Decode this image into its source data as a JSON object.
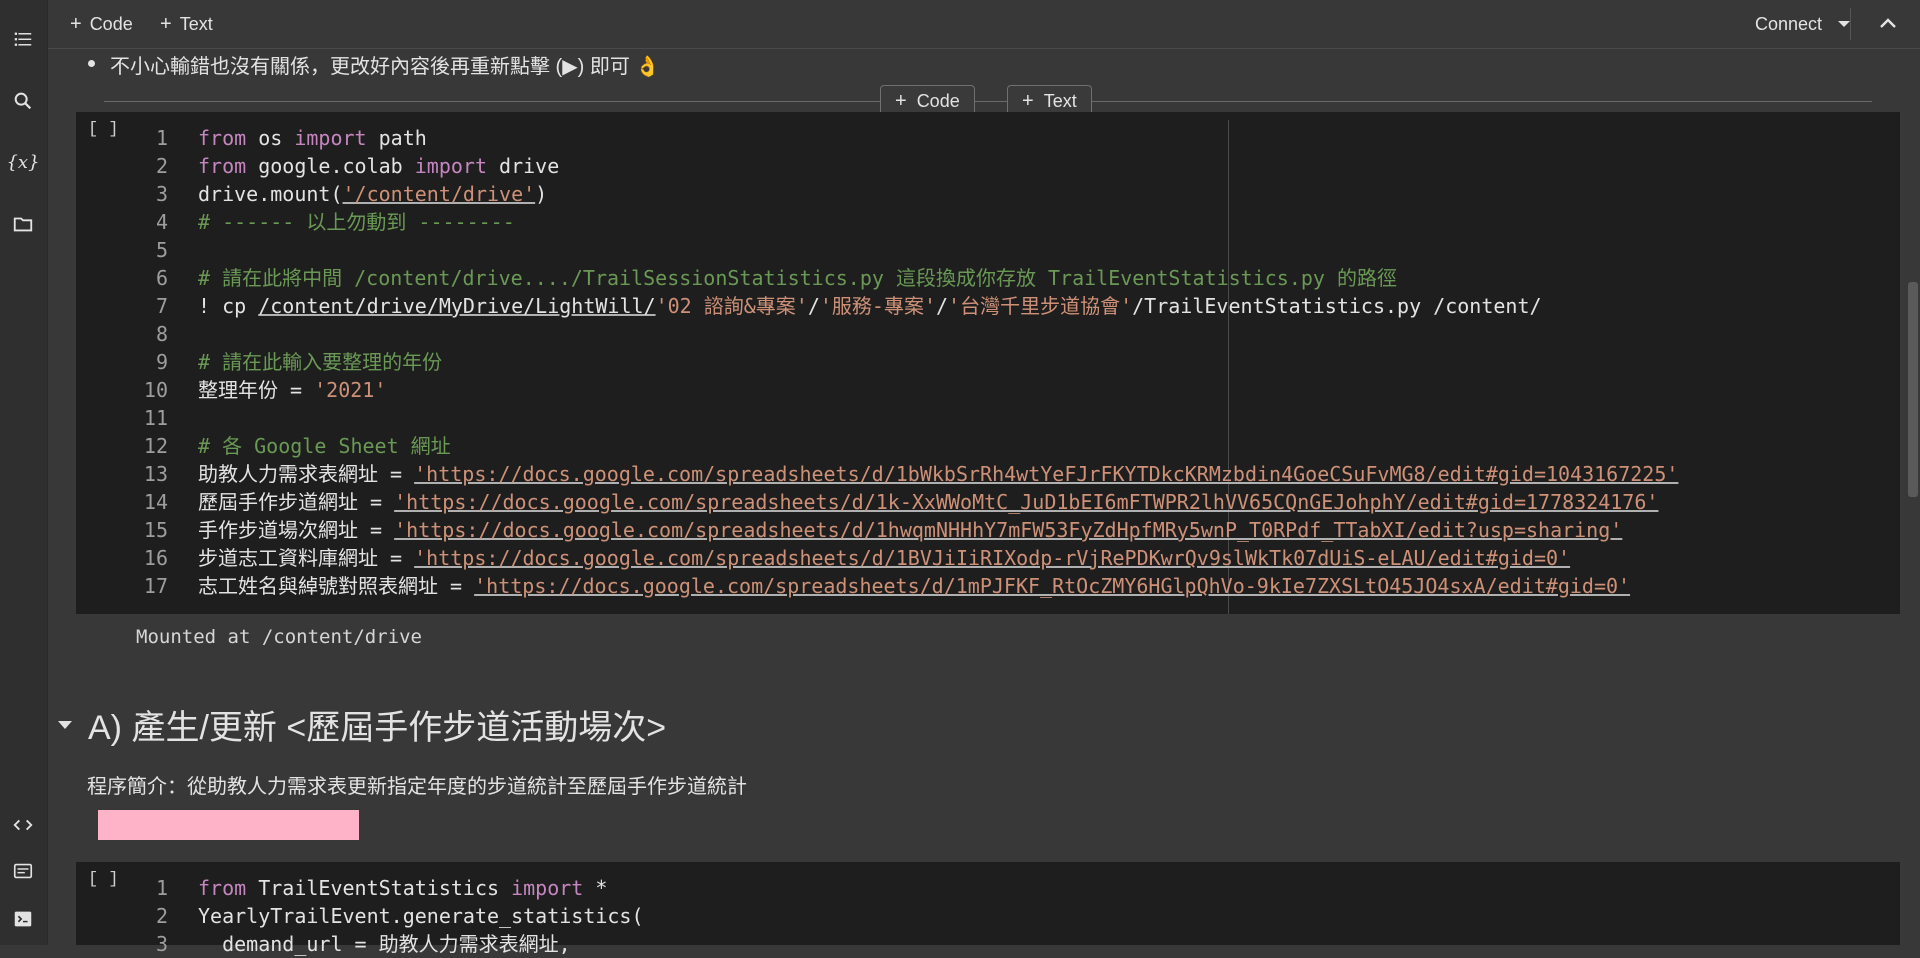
{
  "toolbar": {
    "code_label": "Code",
    "text_label": "Text",
    "connect_label": "Connect"
  },
  "sidebar": {
    "items": [
      {
        "icon": "toc-icon"
      },
      {
        "icon": "search-icon"
      },
      {
        "icon": "variables-icon",
        "label": "{x}"
      },
      {
        "icon": "folder-icon"
      }
    ],
    "bottom_items": [
      {
        "icon": "code-snippets-icon"
      },
      {
        "icon": "command-palette-icon"
      },
      {
        "icon": "terminal-icon"
      }
    ]
  },
  "notebook": {
    "bullet_text": "不小心輸錯也沒有關係，更改好內容後再重新點擊 (▶) 即可 👌",
    "insert_code_label": "Code",
    "insert_text_label": "Text",
    "cell1": {
      "run_indicator": "[ ]",
      "line_numbers": [
        "1",
        "2",
        "3",
        "4",
        "5",
        "6",
        "7",
        "8",
        "9",
        "10",
        "11",
        "12",
        "13",
        "14",
        "15",
        "16",
        "17"
      ],
      "lines": {
        "l1_a": "from",
        "l1_b": " os ",
        "l1_c": "import",
        "l1_d": " path",
        "l2_a": "from",
        "l2_b": " google.colab ",
        "l2_c": "import",
        "l2_d": " drive",
        "l3_a": "drive.mount(",
        "l3_b": "'/content/drive'",
        "l3_c": ")",
        "l4": "# ------ 以上勿動到 --------",
        "l6": "# 請在此將中間 /content/drive..../TrailSessionStatistics.py 這段換成你存放 TrailEventStatistics.py 的路徑",
        "l7_a": "! cp ",
        "l7_b": "/content/drive/MyDrive/LightWill/",
        "l7_c": "'02 諮詢&專案'",
        "l7_d": "/",
        "l7_e": "'服務-專案'",
        "l7_f": "/",
        "l7_g": "'台灣千里步道協會'",
        "l7_h": "/TrailEventStatistics.py /content/",
        "l9": "# 請在此輸入要整理的年份",
        "l10_a": "整理年份 = ",
        "l10_b": "'2021'",
        "l12": "# 各 Google Sheet 網址",
        "l13_a": "助教人力需求表網址 = ",
        "l13_b": "'https://docs.google.com/spreadsheets/d/1bWkbSrRh4wtYeFJrFKYTDkcKRMzbdin4GoeCSuFvMG8/edit#gid=1043167225'",
        "l14_a": "歷屆手作步道網址 = ",
        "l14_b": "'https://docs.google.com/spreadsheets/d/1k-XxWWoMtC_JuD1bEI6mFTWPR2lhVV65CQnGEJohphY/edit#gid=1778324176'",
        "l15_a": "手作步道場次網址 = ",
        "l15_b": "'https://docs.google.com/spreadsheets/d/1hwqmNHHhY7mFW53FyZdHpfMRy5wnP_T0RPdf_TTabXI/edit?usp=sharing'",
        "l16_a": "步道志工資料庫網址 = ",
        "l16_b": "'https://docs.google.com/spreadsheets/d/1BVJiIiRIXodp-rVjRePDKwrQv9slWkTk07dUiS-eLAU/edit#gid=0'",
        "l17_a": "志工姓名與綽號對照表網址 = ",
        "l17_b": "'https://docs.google.com/spreadsheets/d/1mPJFKF_RtOcZMY6HGlpQhVo-9kIe7ZXSLtO45JO4sxA/edit#gid=0'"
      },
      "output": "Mounted at /content/drive"
    },
    "section_heading": "A) 產生/更新 <歷屆手作步道活動場次>",
    "section_desc": "程序簡介：從助教人力需求表更新指定年度的步道統計至歷屆手作步道統計",
    "cell2": {
      "run_indicator": "[ ]",
      "line_numbers": [
        "1",
        "2",
        "3"
      ],
      "lines": {
        "l1_a": "from",
        "l1_b": " TrailEventStatistics ",
        "l1_c": "import",
        "l1_d": " *",
        "l2": "YearlyTrailEvent.generate_statistics(",
        "l3": "  demand_url = 助教人力需求表網址,"
      }
    }
  },
  "colors": {
    "keyword": "#c586c0",
    "string": "#ce9178",
    "comment": "#6a9955",
    "cell_bg": "#1e1e1e",
    "page_bg": "#383838"
  }
}
